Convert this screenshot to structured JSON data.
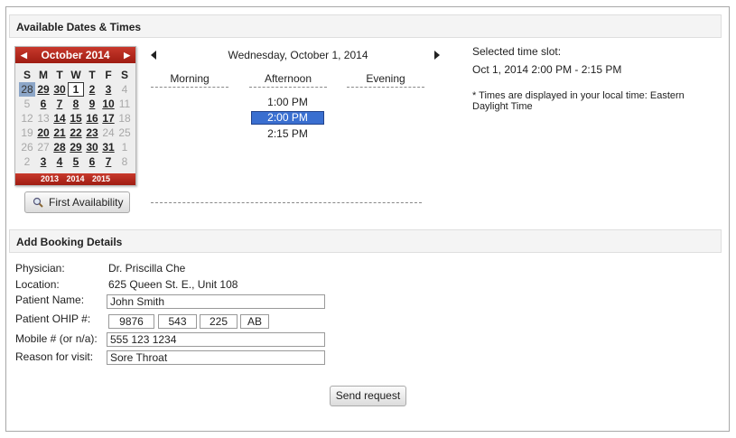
{
  "sections": {
    "dates_title": "Available Dates & Times",
    "booking_title": "Add Booking Details"
  },
  "calendar": {
    "month_label": "October 2014",
    "weekdays": [
      "S",
      "M",
      "T",
      "W",
      "T",
      "F",
      "S"
    ],
    "weeks": [
      [
        {
          "d": "28",
          "s": "selected"
        },
        {
          "d": "29",
          "s": "avail"
        },
        {
          "d": "30",
          "s": "avail"
        },
        {
          "d": "1",
          "s": "today"
        },
        {
          "d": "2",
          "s": "avail"
        },
        {
          "d": "3",
          "s": "avail"
        },
        {
          "d": "4",
          "s": "other"
        }
      ],
      [
        {
          "d": "5",
          "s": "other"
        },
        {
          "d": "6",
          "s": "avail"
        },
        {
          "d": "7",
          "s": "avail"
        },
        {
          "d": "8",
          "s": "avail"
        },
        {
          "d": "9",
          "s": "avail"
        },
        {
          "d": "10",
          "s": "avail"
        },
        {
          "d": "11",
          "s": "other"
        }
      ],
      [
        {
          "d": "12",
          "s": "other"
        },
        {
          "d": "13",
          "s": "other"
        },
        {
          "d": "14",
          "s": "avail"
        },
        {
          "d": "15",
          "s": "avail"
        },
        {
          "d": "16",
          "s": "avail"
        },
        {
          "d": "17",
          "s": "avail"
        },
        {
          "d": "18",
          "s": "other"
        }
      ],
      [
        {
          "d": "19",
          "s": "other"
        },
        {
          "d": "20",
          "s": "avail"
        },
        {
          "d": "21",
          "s": "avail"
        },
        {
          "d": "22",
          "s": "avail"
        },
        {
          "d": "23",
          "s": "avail"
        },
        {
          "d": "24",
          "s": "other"
        },
        {
          "d": "25",
          "s": "other"
        }
      ],
      [
        {
          "d": "26",
          "s": "other"
        },
        {
          "d": "27",
          "s": "other"
        },
        {
          "d": "28",
          "s": "avail"
        },
        {
          "d": "29",
          "s": "avail"
        },
        {
          "d": "30",
          "s": "avail"
        },
        {
          "d": "31",
          "s": "avail"
        },
        {
          "d": "1",
          "s": "other"
        }
      ],
      [
        {
          "d": "2",
          "s": "other"
        },
        {
          "d": "3",
          "s": "avail"
        },
        {
          "d": "4",
          "s": "avail"
        },
        {
          "d": "5",
          "s": "avail"
        },
        {
          "d": "6",
          "s": "avail"
        },
        {
          "d": "7",
          "s": "avail"
        },
        {
          "d": "8",
          "s": "other"
        }
      ]
    ],
    "years": [
      "2013",
      "2014",
      "2015"
    ]
  },
  "first_availability_label": "First Availability",
  "schedule": {
    "date_title": "Wednesday, October 1, 2014",
    "periods": [
      "Morning",
      "Afternoon",
      "Evening"
    ],
    "slots": [
      {
        "time": "1:00 PM",
        "selected": false
      },
      {
        "time": "2:00 PM",
        "selected": true
      },
      {
        "time": "2:15 PM",
        "selected": false
      }
    ]
  },
  "selected_slot": {
    "label": "Selected time slot:",
    "value": "Oct 1, 2014 2:00 PM - 2:15 PM",
    "note": "* Times are displayed in your local time: Eastern Daylight Time"
  },
  "booking": {
    "physician_label": "Physician:",
    "physician_value": "Dr. Priscilla Che",
    "location_label": "Location:",
    "location_value": "625 Queen St. E., Unit 108",
    "patient_name_label": "Patient Name:",
    "patient_name_value": "John Smith",
    "ohip_label": "Patient OHIP #:",
    "ohip_parts": [
      "9876",
      "543",
      "225",
      "AB"
    ],
    "mobile_label": "Mobile # (or n/a):",
    "mobile_value": "555 123 1234",
    "reason_label": "Reason for visit:",
    "reason_value": "Sore Throat"
  },
  "send_label": "Send request",
  "colors": {
    "calendar_red": "#b02a1f",
    "slot_selected": "#3a6fd0",
    "day_selected": "#8ca6c8"
  }
}
